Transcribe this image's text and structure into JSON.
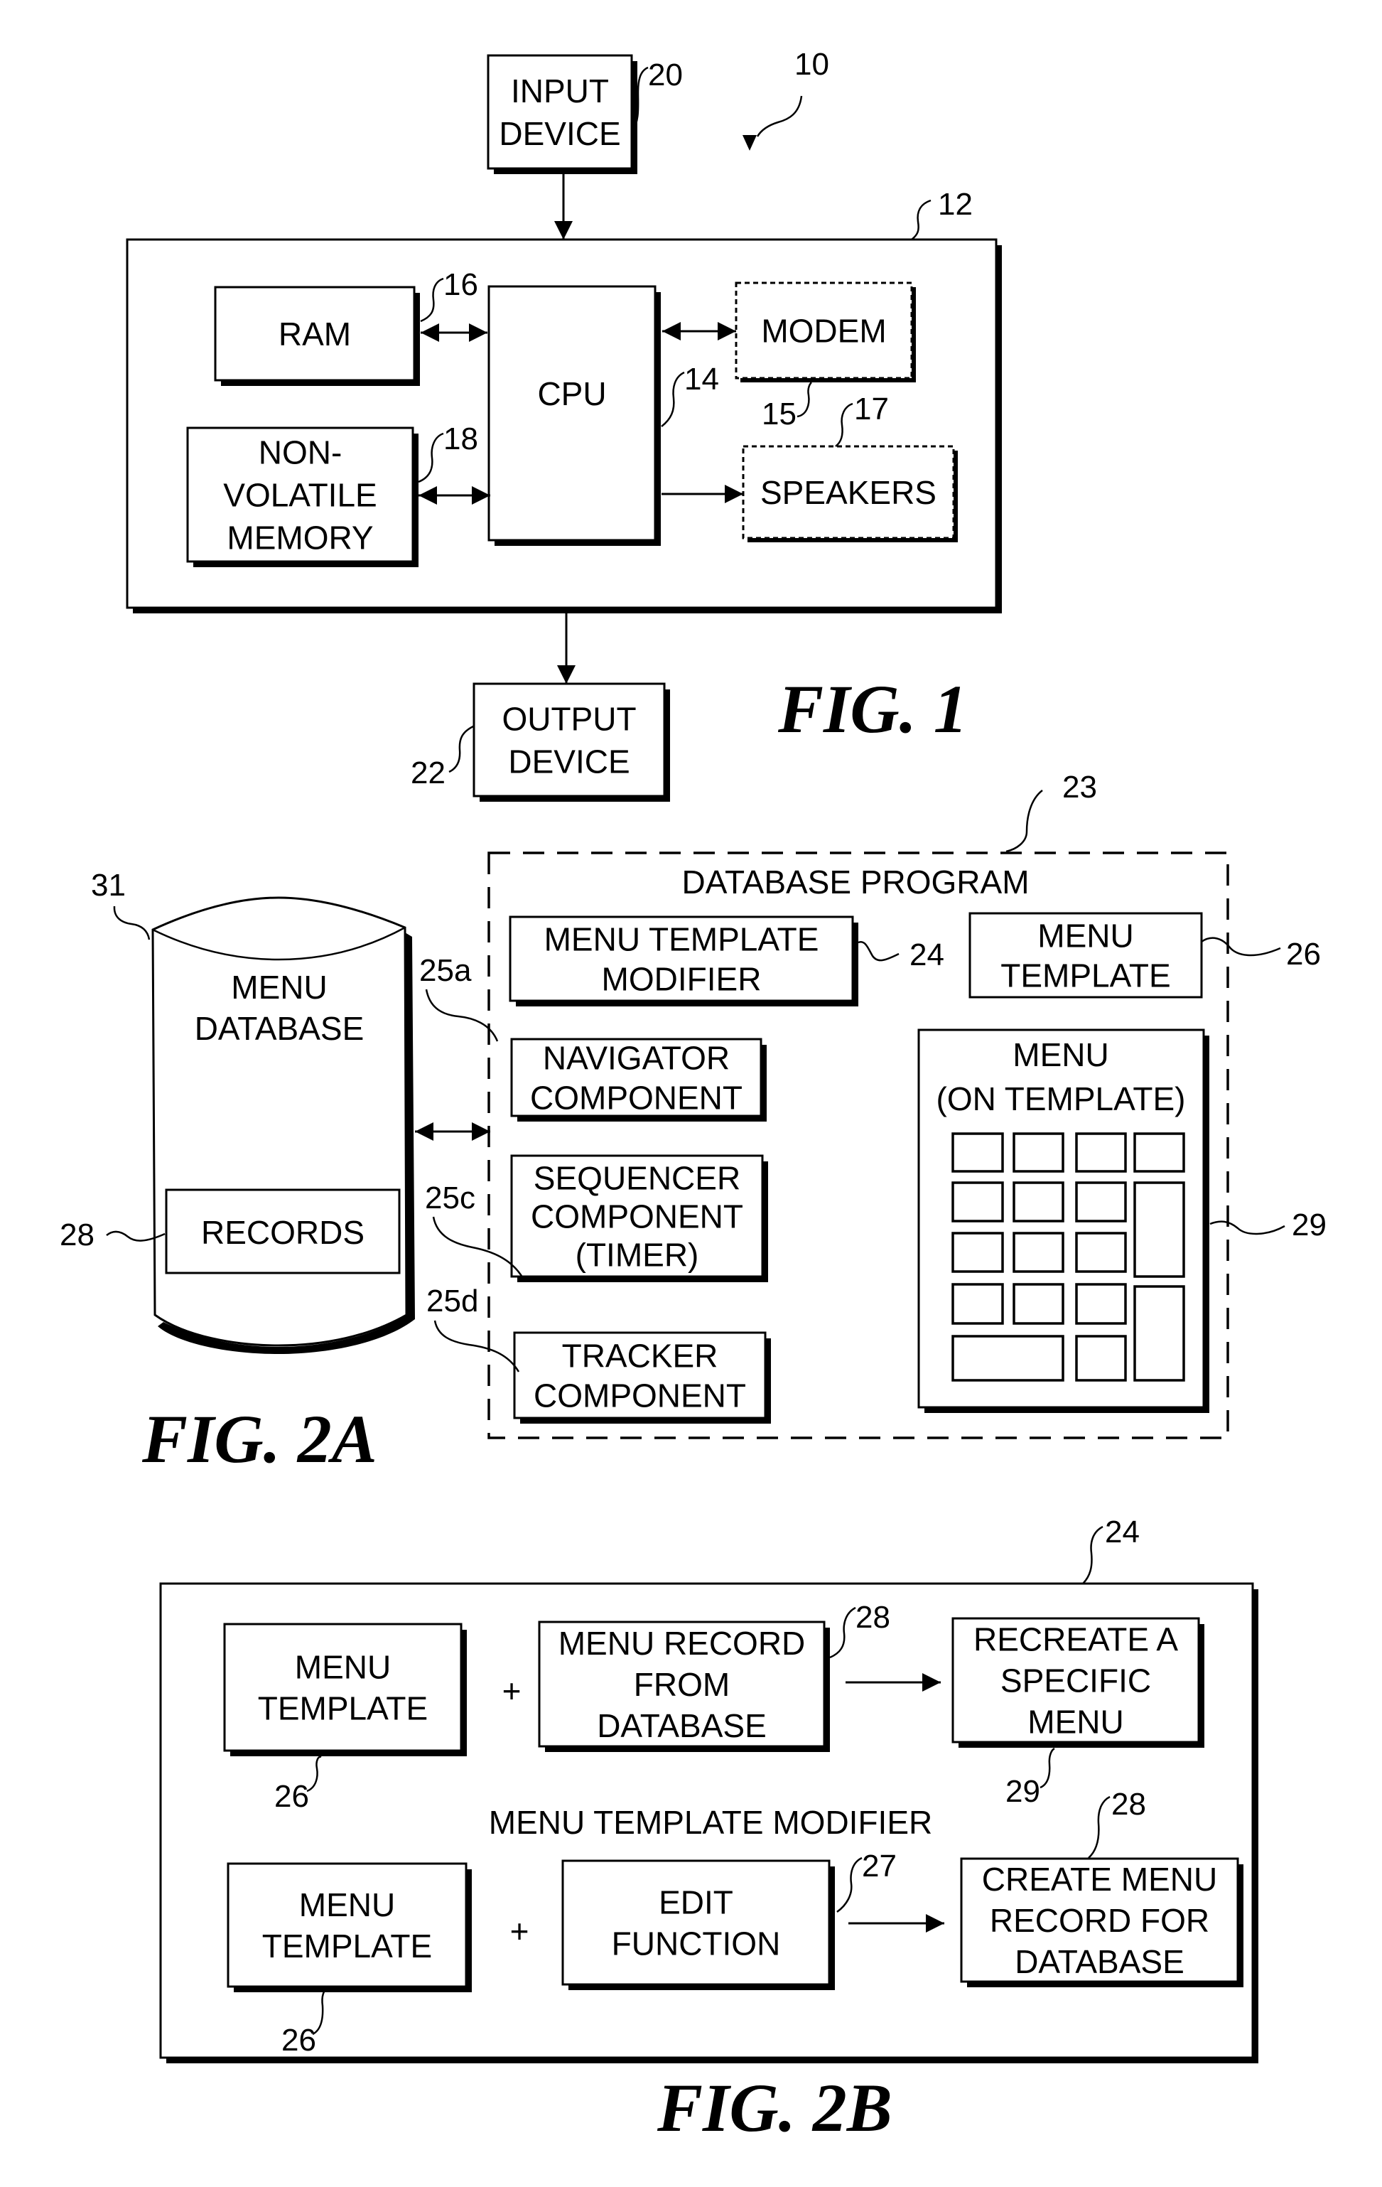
{
  "figures": {
    "fig1": {
      "caption": "FIG. 1",
      "system_ref": "10",
      "input_device": {
        "lines": [
          "INPUT",
          "DEVICE"
        ],
        "ref": "20"
      },
      "computer": {
        "ref": "12"
      },
      "ram": {
        "lines": [
          "RAM"
        ],
        "ref": "16"
      },
      "cpu": {
        "lines": [
          "CPU"
        ],
        "ref": "14"
      },
      "modem": {
        "lines": [
          "MODEM"
        ],
        "ref": "15",
        "optional": true
      },
      "speakers": {
        "lines": [
          "SPEAKERS"
        ],
        "ref": "17",
        "optional": true
      },
      "nvm": {
        "lines": [
          "NON-",
          "VOLATILE",
          "MEMORY"
        ],
        "ref": "18"
      },
      "output_device": {
        "lines": [
          "OUTPUT",
          "DEVICE"
        ],
        "ref": "22"
      }
    },
    "fig2a": {
      "caption": "FIG. 2A",
      "menu_database": {
        "lines": [
          "MENU",
          "DATABASE"
        ],
        "ref": "31"
      },
      "records": {
        "lines": [
          "RECORDS"
        ],
        "ref": "28"
      },
      "database_program": {
        "title": "DATABASE PROGRAM",
        "ref": "23"
      },
      "menu_template_modifier": {
        "lines": [
          "MENU TEMPLATE",
          "MODIFIER"
        ],
        "ref": "24"
      },
      "menu_template": {
        "lines": [
          "MENU",
          "TEMPLATE"
        ],
        "ref": "26"
      },
      "navigator": {
        "lines": [
          "NAVIGATOR",
          "COMPONENT"
        ],
        "ref": "25a"
      },
      "sequencer": {
        "lines": [
          "SEQUENCER",
          "COMPONENT",
          "(TIMER)"
        ],
        "ref": "25c"
      },
      "tracker": {
        "lines": [
          "TRACKER",
          "COMPONENT"
        ],
        "ref": "25d"
      },
      "menu_on_template": {
        "lines": [
          "MENU",
          "(ON TEMPLATE)"
        ],
        "ref": "29",
        "highlighted_cell": "row 3, column 2"
      }
    },
    "fig2b": {
      "caption": "FIG. 2B",
      "frame_ref": "24",
      "frame_title": "MENU TEMPLATE MODIFIER",
      "row1": {
        "template": {
          "lines": [
            "MENU",
            "TEMPLATE"
          ],
          "ref": "26"
        },
        "operator": "+",
        "record": {
          "lines": [
            "MENU RECORD",
            "FROM",
            "DATABASE"
          ],
          "ref": "28"
        },
        "result": {
          "lines": [
            "RECREATE A",
            "SPECIFIC",
            "MENU"
          ],
          "ref": "29"
        }
      },
      "row2": {
        "template": {
          "lines": [
            "MENU",
            "TEMPLATE"
          ],
          "ref": "26"
        },
        "operator": "+",
        "edit": {
          "lines": [
            "EDIT",
            "FUNCTION"
          ],
          "ref": "27"
        },
        "result": {
          "lines": [
            "CREATE MENU",
            "RECORD FOR",
            "DATABASE"
          ],
          "ref": "28"
        }
      }
    }
  }
}
